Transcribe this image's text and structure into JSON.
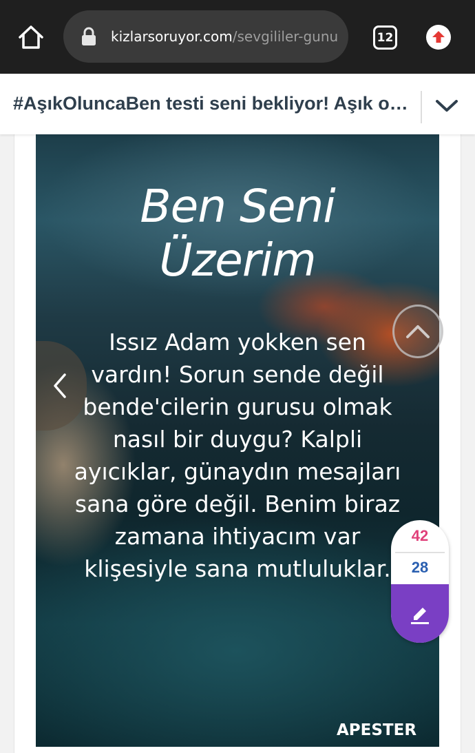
{
  "browser": {
    "url_domain": "kizlarsoruyor.com",
    "url_path": "/sevgililer-gunu",
    "tab_count": "12",
    "icons": [
      "home-icon",
      "lock-icon",
      "tabs-icon",
      "update-icon"
    ]
  },
  "header": {
    "title": "#AşıkOluncaBen testi seni bekliyor! Aşık olunca neler yapıyorsun?",
    "icons": [
      "chevron-down-icon"
    ]
  },
  "widget": {
    "title_line1": "Ben Seni",
    "title_line2": "Üzerim",
    "body": "Issız Adam yokken sen vardın! Sorun sende değil bende'cilerin gurusu olmak nasıl bir duygu? Kalpli ayıcıklar, günaydın mesajları sana göre değil. Benim biraz zamana ihtiyacım var klişesiyle sana mutluluklar.",
    "brand": "APESTER",
    "icons": [
      "chevron-left-icon"
    ]
  },
  "votes": {
    "up": "42",
    "down": "28",
    "icons": [
      "edit-icon",
      "chevron-up-icon"
    ]
  }
}
